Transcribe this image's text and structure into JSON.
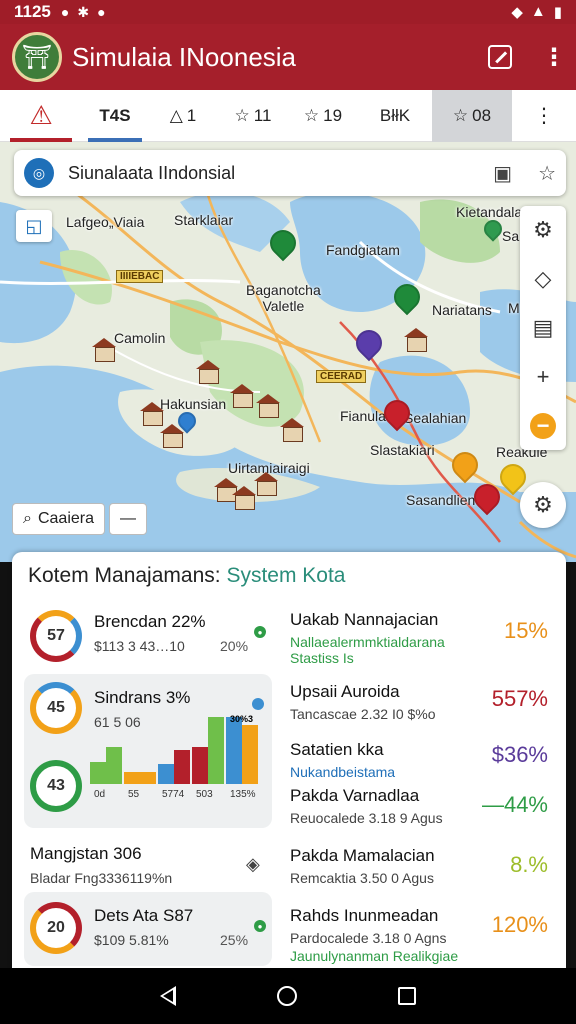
{
  "status_bar": {
    "time": "1125",
    "icons": [
      "camera-icon",
      "fan-icon",
      "dot-icon"
    ],
    "right_icons": [
      "wifi-icon",
      "signal-icon",
      "battery-icon"
    ]
  },
  "app_bar": {
    "title": "Simulaia INoonesia",
    "logo_icon": "temple-logo",
    "actions": [
      "edit-icon",
      "more-icon"
    ]
  },
  "tabs": [
    {
      "label": "",
      "icon": "warning-icon"
    },
    {
      "label": "T4S"
    },
    {
      "label": "1",
      "icon": "triangle-icon"
    },
    {
      "label": "11",
      "icon": "star-icon"
    },
    {
      "label": "19",
      "icon": "star-icon"
    },
    {
      "label": "BłłK"
    },
    {
      "label": "08",
      "icon": "star-icon"
    }
  ],
  "map": {
    "search_title": "Siunalaata IIndonsial",
    "labels": [
      "Lafgeo„Viaia",
      "Starklaiar",
      "Fandgiatam",
      "Baganotcha\nValetle",
      "Camolin",
      "Hakunsian",
      "Nariatans",
      "Fianula",
      "Sealahian",
      "Slastakiari",
      "Uirtamiairaigi",
      "Sasandlien",
      "Kietandalan",
      "Sa",
      "M",
      "Reakuie"
    ],
    "road_labels": [
      "IIIIEBAC",
      "CEERAD"
    ],
    "bottom_buttons": [
      "Caaiera",
      "—"
    ]
  },
  "colors": {
    "brand": "#a51f2b",
    "accent_teal": "#2a8d7a",
    "orange": "#f2a118",
    "green": "#2e9c46",
    "blue": "#3c8fd1"
  },
  "panel": {
    "title_main": "Kotem Manajamans: ",
    "title_accent": "System Kota",
    "left": [
      {
        "ring": "57",
        "title": "Brencdan 22%",
        "sub": "$113 3 43…10",
        "pct": "20%"
      },
      {
        "ring": "45",
        "title": "Sindrans 3%",
        "sub": "61 5 06",
        "ring2": "43",
        "chart_top": "30%3"
      },
      {
        "title": "Mangjstan 306",
        "sub": "Bladar Fng3336119%n"
      },
      {
        "ring": "20",
        "title": "Dets Ata S87",
        "sub": "$109 5.81%",
        "pct": "25%"
      }
    ],
    "right": [
      {
        "title": "Uakab Nannajacian",
        "sub": "Nallaealermmktialdarana",
        "sub2": "Stastiss Is",
        "value": "15%",
        "color": "#e8901a"
      },
      {
        "title": "Upsaii Auroida",
        "sub": "Tancascae 2.32 I0 $%o",
        "value": "557%",
        "color": "#b3202b"
      },
      {
        "title": "Satatien kka",
        "sub": "Nukandbeistama",
        "value": "$36%",
        "color": "#5a3b9a"
      },
      {
        "title": "Pakda Varnadlaa",
        "sub": "Reuocalede 3.18 9 Agus",
        "value": "—44%",
        "color": "#2e9c46"
      },
      {
        "title": "Pakda Mamalacian",
        "sub": "Remcaktia 3.50 0 Agus",
        "value": "8.%",
        "color": "#9dbd2a"
      },
      {
        "title": "Rahds Inunmeadan",
        "sub": "Pardocalede 3.18 0 Agns",
        "sub2": "Jaunulynanman Realikgiae",
        "value": "120%",
        "color": "#e8901a"
      }
    ]
  },
  "chart_data": {
    "type": "bar",
    "categories": [
      "0d",
      "55",
      "5774",
      "503",
      "135%"
    ],
    "series": [
      {
        "values": [
          26,
          14,
          24,
          44,
          80
        ]
      },
      {
        "values": [
          44,
          14,
          40,
          80,
          70
        ]
      }
    ]
  }
}
